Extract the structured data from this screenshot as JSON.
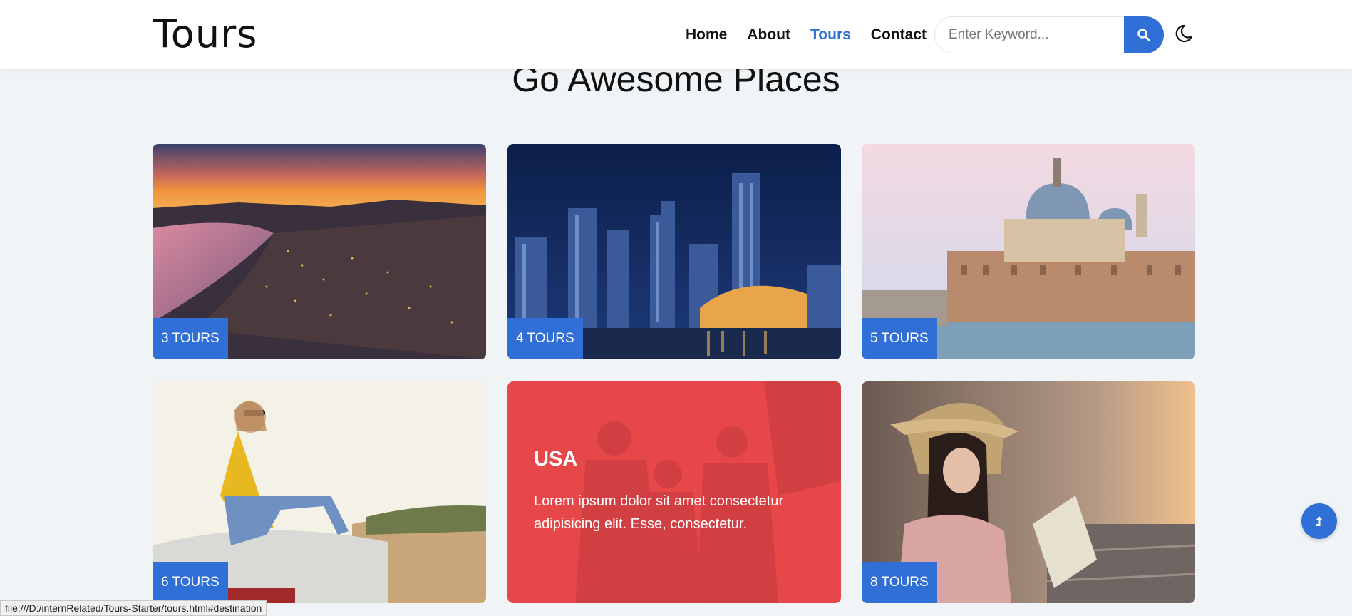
{
  "header": {
    "logo": "Tours",
    "nav": [
      {
        "label": "Home",
        "active": false
      },
      {
        "label": "About",
        "active": false
      },
      {
        "label": "Tours",
        "active": true
      },
      {
        "label": "Contact",
        "active": false
      }
    ],
    "search_placeholder": "Enter Keyword...",
    "search_icon": "search-icon",
    "theme_icon": "moon-icon"
  },
  "section": {
    "title": "Go Awesome Places"
  },
  "cards": [
    {
      "badge": "3 TOURS",
      "image": "coastal-city-sunset"
    },
    {
      "badge": "4 TOURS",
      "image": "night-skyline"
    },
    {
      "badge": "5 TOURS",
      "image": "venice-canal"
    },
    {
      "badge": "6 TOURS",
      "image": "woman-on-car"
    },
    {
      "title": "USA",
      "text": "Lorem ipsum dolor sit amet consectetur adipisicing elit. Esse, consectetur.",
      "image": "friends-sightseeing"
    },
    {
      "badge": "8 TOURS",
      "image": "traveler-with-map"
    }
  ],
  "back_to_top_icon": "arrow-up-icon",
  "status_bar": "file:///D:/internRelated/Tours-Starter/tours.html#destination",
  "colors": {
    "accent": "#2f6fd6",
    "overlay": "#e8474a",
    "background": "#f0f4f7"
  }
}
